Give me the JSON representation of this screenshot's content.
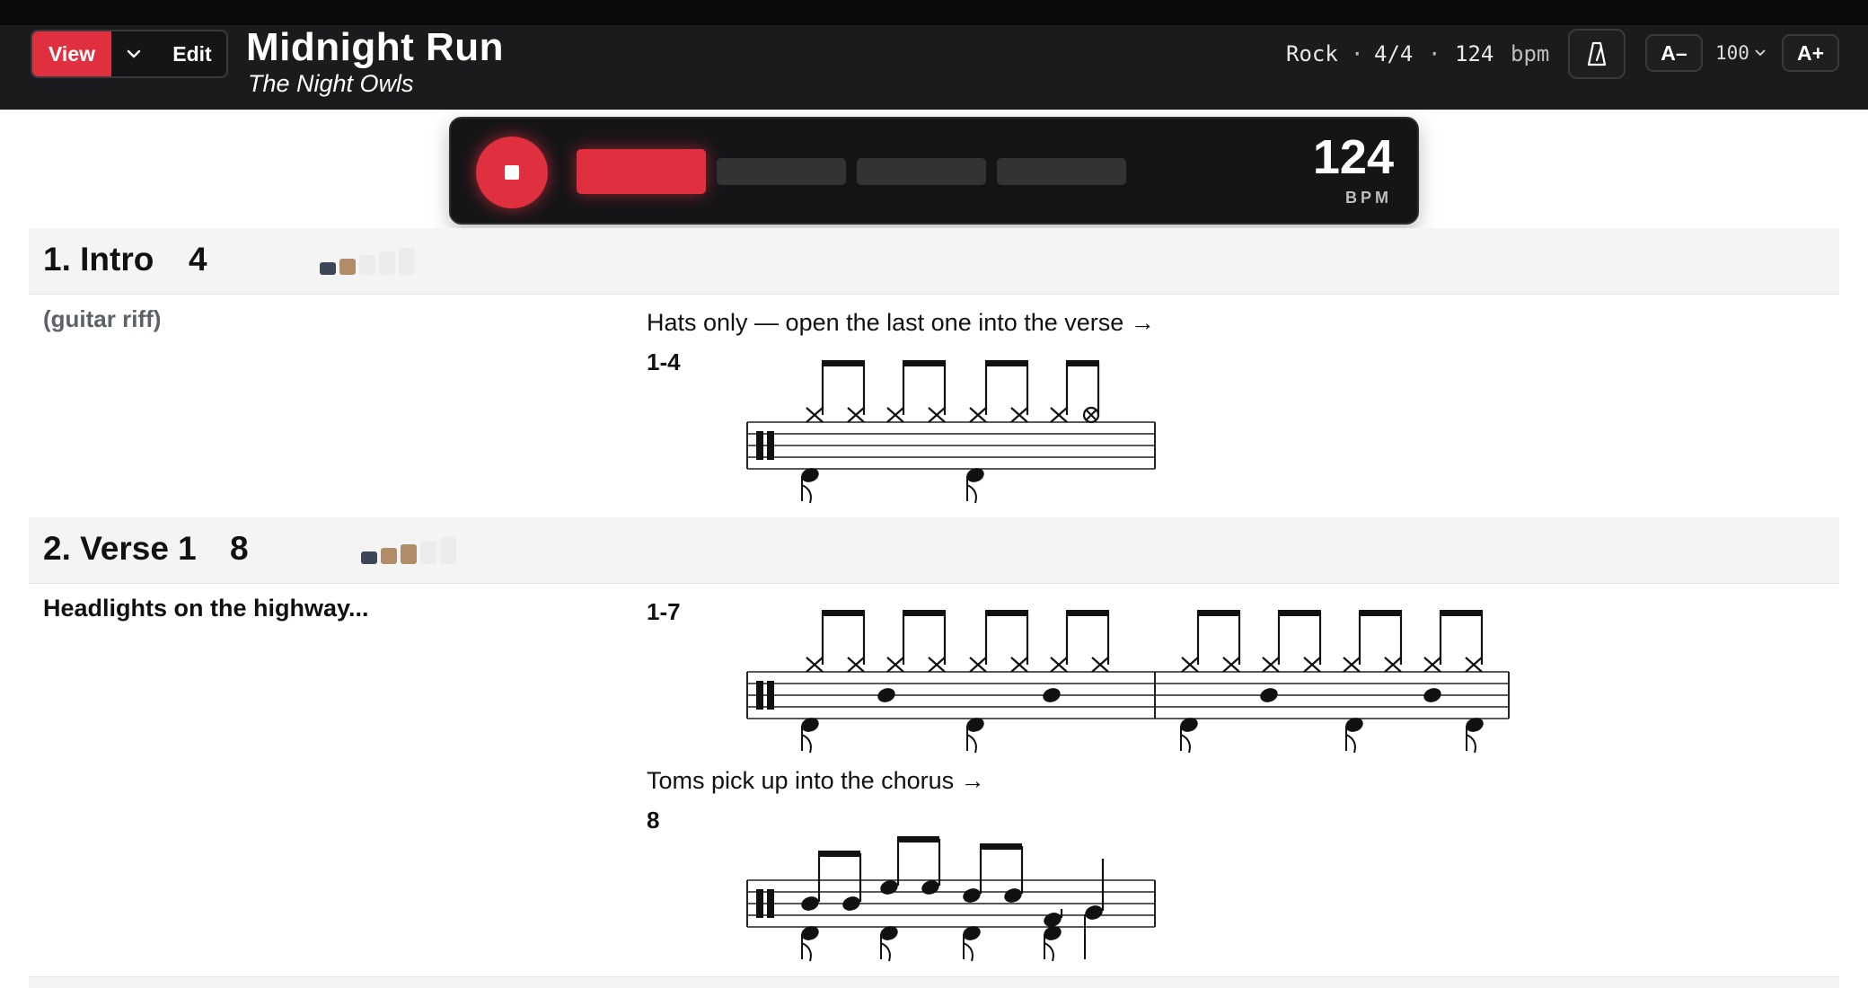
{
  "header": {
    "view_label": "View",
    "edit_label": "Edit",
    "song_title": "Midnight Run",
    "artist": "The Night Owls",
    "genre": "Rock",
    "separator": "·",
    "time_signature": "4/4",
    "tempo": "124",
    "tempo_unit": "bpm",
    "font_decrease": "A–",
    "zoom_value": "100",
    "font_increase": "A+"
  },
  "transport": {
    "bpm_value": "124",
    "bpm_label": "BPM",
    "beats": 4,
    "active_beat": 1,
    "accent_color": "#e0303f"
  },
  "sections": [
    {
      "title": "1. Intro",
      "bars": "4",
      "dynamics_level": 2,
      "dynamics_total": 5,
      "lyric": "(guitar riff)",
      "note": "Hats only — open the last one into the verse →",
      "bar_range": "1-4"
    },
    {
      "title": "2. Verse 1",
      "bars": "8",
      "dynamics_level": 3,
      "dynamics_total": 5,
      "lyric": "Headlights on the highway...",
      "bar_range": "1-7",
      "note": "Toms pick up into the chorus →",
      "bar_range_2": "8"
    }
  ],
  "colors": {
    "header_bg": "#1b1b1d",
    "accent": "#e0303f",
    "dyn_dark": "#3d4656",
    "dyn_warm": "#b08d68",
    "dyn_empty": "#ececed"
  }
}
